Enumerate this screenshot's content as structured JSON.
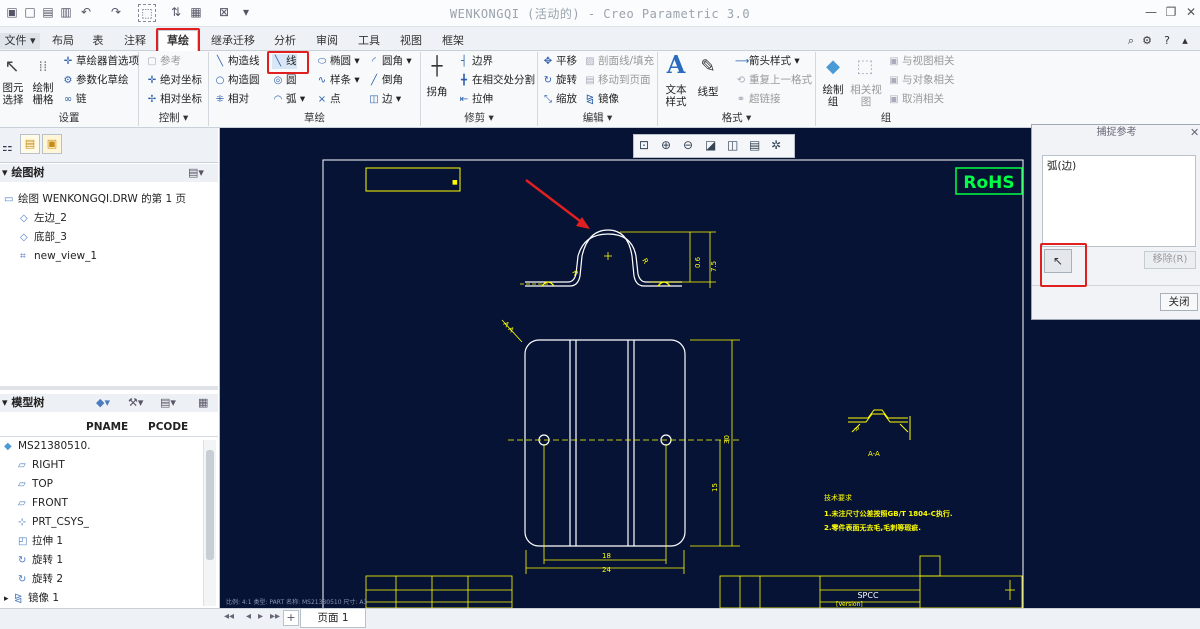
{
  "window": {
    "title": "WENKONGQI (活动的) - Creo Parametric 3.0",
    "controls": [
      "—",
      "❐",
      "✕"
    ]
  },
  "menu": {
    "file": "文件",
    "tabs": [
      "布局",
      "表",
      "注释",
      "草绘",
      "继承迁移",
      "分析",
      "审阅",
      "工具",
      "视图",
      "框架"
    ],
    "active_tab": "草绘"
  },
  "ribbon": {
    "setup": {
      "select": "图元\n选择",
      "grid": "绘制\n栅格",
      "prefs": "草绘器首选项",
      "param_sketch": "参数化草绘",
      "chain": "链",
      "label": "设置"
    },
    "control": {
      "ref": "参考",
      "abs_coord": "绝对坐标",
      "rel_coord": "相对坐标",
      "label": "控制"
    },
    "sketch": {
      "construct_line": "构造线",
      "construct_circle": "构造圆",
      "relative": "相对",
      "line": "线",
      "circle": "圆",
      "arc": "弧",
      "ellipse": "椭圆",
      "spline": "样条",
      "point": "点",
      "fillet": "圆角",
      "chamfer": "倒角",
      "edge": "边",
      "label": "草绘"
    },
    "trim": {
      "corner": "拐角",
      "boundary": "边界",
      "divide": "在相交处分割",
      "stretch": "拉伸",
      "label": "修剪"
    },
    "edit": {
      "translate": "平移",
      "rotate": "旋转",
      "scale": "缩放",
      "section_fill": "剖面线/填充",
      "move_to_page": "移动到页面",
      "mirror": "镜像",
      "label": "编辑"
    },
    "format": {
      "text_style": "文本\n样式",
      "line_style": "线型",
      "arrow_style": "箭头样式",
      "repeat_format": "重复上一格式",
      "hyperlink": "超链接",
      "label": "格式"
    },
    "group": {
      "draw_group": "绘制\n组",
      "related_view": "相关视\n图",
      "relate_to_view": "与视图相关",
      "relate_to_object": "与对象相关",
      "cancel_relation": "取消相关",
      "label": "组"
    }
  },
  "drawing_tree": {
    "title": "绘图树",
    "items": [
      "绘图 WENKONGQI.DRW 的第 1 页",
      "左边_2",
      "底部_3",
      "new_view_1"
    ]
  },
  "model_tree": {
    "title": "模型树",
    "columns": [
      "PNAME",
      "PCODE"
    ],
    "items": [
      "MS21380510.",
      "RIGHT",
      "TOP",
      "FRONT",
      "PRT_CSYS_",
      "拉伸 1",
      "旋转 1",
      "旋转 2",
      "镜像 1"
    ]
  },
  "drawing": {
    "rohs": "RoHS",
    "section_label": "A-A",
    "notes_title": "技术要求",
    "note1": "1.未注尺寸公差按照GB/T 1804-C执行.",
    "note2": "2.零件表面无去毛,毛刺等瑕疵.",
    "material": "SPCC",
    "version": "[Version]",
    "status_line": "比例: 4:1    类型: PART    名称: MS21380510    尺寸: A3",
    "dims": {
      "d18": "18",
      "d24": "24",
      "d15": "15",
      "d30": "30",
      "d75": "7.5",
      "d06": "0.6"
    }
  },
  "snap_dialog": {
    "title": "捕捉参考",
    "list_item": "弧(边)",
    "remove": "移除(R)",
    "close": "关闭"
  },
  "footer": {
    "page": "页面  1"
  },
  "colors": {
    "canvas": "#061335",
    "drawing_lines": "#ffffff",
    "annotations": "#ffff00",
    "highlight": "#e02020"
  }
}
